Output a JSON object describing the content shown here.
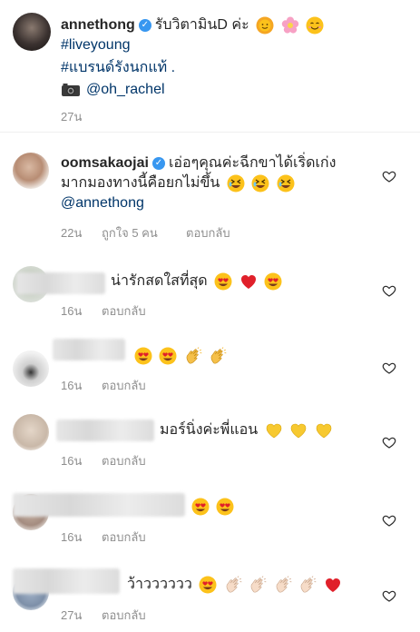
{
  "post": {
    "username": "annethong",
    "caption_text": "รับวิตามินD ค่ะ",
    "hashtag1": "#liveyoung",
    "hashtag2": "#แบรนด์รังนกแท้ .",
    "mention": "@oh_rachel",
    "time": "27น"
  },
  "comments": [
    {
      "username": "oomsakaojai",
      "text_line1": "เอ่อๆคุณค่ะฉีกขาได้เริ่ดเก่ง",
      "text_line2": "มากมองทางนี้คือยกไม่ขึ้น",
      "mention": "@annethong",
      "time": "22น",
      "likes": "ถูกใจ 5 คน",
      "reply": "ตอบกลับ"
    },
    {
      "text": "น่ารักสดใสที่สุด",
      "time": "16น",
      "reply": "ตอบกลับ"
    },
    {
      "text": "",
      "time": "16น",
      "reply": "ตอบกลับ"
    },
    {
      "text": "มอร์นิ่งค่ะพี่แอน",
      "time": "16น",
      "reply": "ตอบกลับ"
    },
    {
      "text": "",
      "time": "16น",
      "reply": "ตอบกลับ"
    },
    {
      "text": "ว้าวววววว",
      "time": "27น",
      "reply": "ตอบกลับ"
    }
  ],
  "colors": {
    "verified": "#3897f0",
    "meta": "#8e8e8e",
    "link": "#003569"
  },
  "icons": [
    "verified-icon",
    "heart-outline-icon",
    "camera-icon"
  ]
}
